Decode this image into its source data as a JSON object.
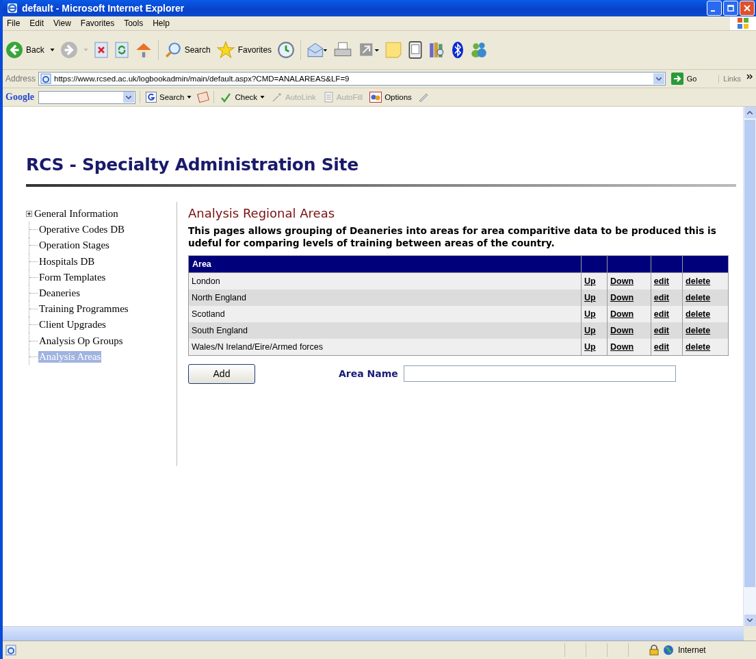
{
  "window": {
    "title": "default - Microsoft Internet Explorer"
  },
  "menu": [
    "File",
    "Edit",
    "View",
    "Favorites",
    "Tools",
    "Help"
  ],
  "toolbar": {
    "back": "Back",
    "search": "Search",
    "favorites": "Favorites"
  },
  "address": {
    "label": "Address",
    "url": "https://www.rcsed.ac.uk/logbookadmin/main/default.aspx?CMD=ANALAREAS&LF=9",
    "go": "Go",
    "links": "Links"
  },
  "google_bar": {
    "logo": "Google",
    "search": "Search",
    "check": "Check",
    "autolink": {
      "label": "AutoLink",
      "disabled": true
    },
    "autofill": {
      "label": "AutoFill",
      "disabled": true
    },
    "options": "Options"
  },
  "page": {
    "site_title": "RCS - Specialty Administration Site",
    "sidebar": [
      {
        "label": "General Information",
        "collapsed": true,
        "selected": false
      },
      {
        "label": "Operative Codes DB",
        "collapsed": false,
        "selected": false
      },
      {
        "label": "Operation Stages",
        "collapsed": false,
        "selected": false
      },
      {
        "label": "Hospitals DB",
        "collapsed": false,
        "selected": false
      },
      {
        "label": "Form Templates",
        "collapsed": false,
        "selected": false
      },
      {
        "label": "Deaneries",
        "collapsed": false,
        "selected": false
      },
      {
        "label": "Training Programmes",
        "collapsed": false,
        "selected": false
      },
      {
        "label": "Client Upgrades",
        "collapsed": false,
        "selected": false
      },
      {
        "label": "Analysis Op Groups",
        "collapsed": false,
        "selected": false
      },
      {
        "label": "Analysis Areas",
        "collapsed": false,
        "selected": true
      }
    ],
    "heading": "Analysis Regional Areas",
    "description": "This pages allows grouping of Deaneries into areas for area comparitive data to be produced this is udeful for comparing levels of training between areas of the country.",
    "table": {
      "columns": [
        "Area"
      ],
      "rows": [
        {
          "area": "London",
          "actions": [
            "Up",
            "Down",
            "edit",
            "delete"
          ]
        },
        {
          "area": "North England",
          "actions": [
            "Up",
            "Down",
            "edit",
            "delete"
          ]
        },
        {
          "area": "Scotland",
          "actions": [
            "Up",
            "Down",
            "edit",
            "delete"
          ]
        },
        {
          "area": "South England",
          "actions": [
            "Up",
            "Down",
            "edit",
            "delete"
          ]
        },
        {
          "area": "Wales/N Ireland/Eire/Armed forces",
          "actions": [
            "Up",
            "Down",
            "edit",
            "delete"
          ]
        }
      ]
    },
    "add_button": "Add",
    "area_name_label": "Area Name"
  },
  "status_bar": {
    "zone": "Internet"
  }
}
